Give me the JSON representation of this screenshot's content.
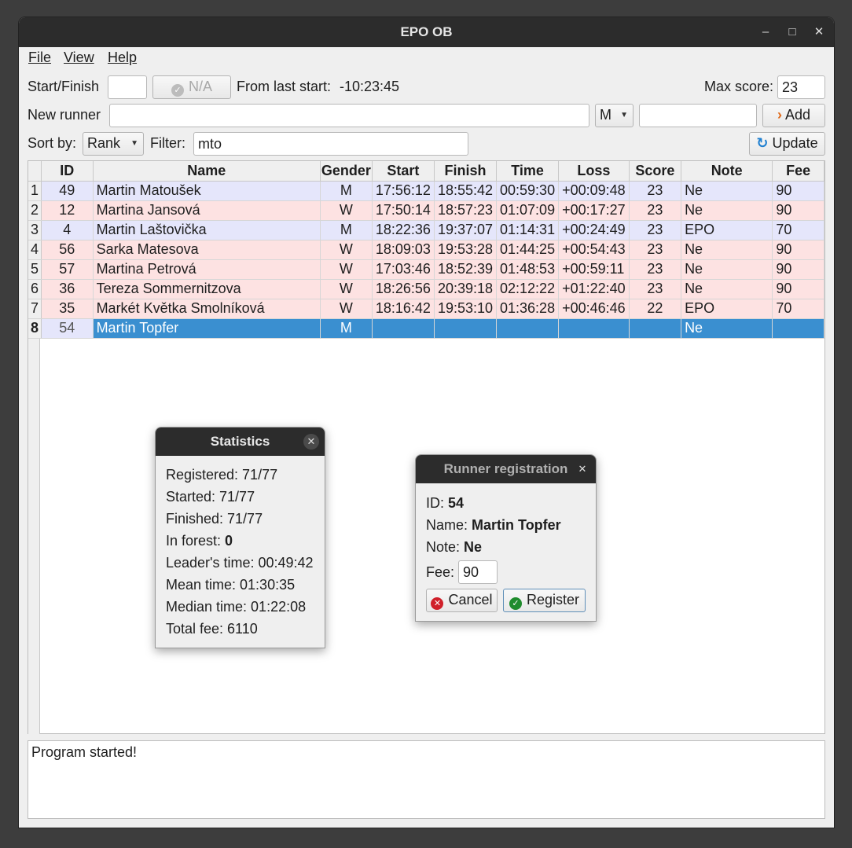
{
  "window": {
    "title": "EPO OB"
  },
  "menu": {
    "file": "File",
    "view": "View",
    "help": "Help"
  },
  "toolbar": {
    "start_finish_label": "Start/Finish",
    "start_finish_value": "",
    "na_button": "N/A",
    "from_last_start_label": "From last start:",
    "from_last_start_value": "-10:23:45",
    "max_score_label": "Max score:",
    "max_score_value": "23",
    "new_runner_label": "New runner",
    "new_runner_value": "",
    "gender_value": "M",
    "runner_extra_value": "",
    "add_button": "Add",
    "sort_by_label": "Sort by:",
    "sort_by_value": "Rank",
    "filter_label": "Filter:",
    "filter_value": "mto",
    "update_button": "Update"
  },
  "table": {
    "headers": [
      "ID",
      "Name",
      "Gender",
      "Start",
      "Finish",
      "Time",
      "Loss",
      "Score",
      "Note",
      "Fee"
    ],
    "rows": [
      {
        "n": "1",
        "id": "49",
        "name": "Martin Matoušek",
        "gender": "M",
        "start": "17:56:12",
        "finish": "18:55:42",
        "time": "00:59:30",
        "loss": "+00:09:48",
        "score": "23",
        "note": "Ne",
        "fee": "90"
      },
      {
        "n": "2",
        "id": "12",
        "name": "Martina Jansová",
        "gender": "W",
        "start": "17:50:14",
        "finish": "18:57:23",
        "time": "01:07:09",
        "loss": "+00:17:27",
        "score": "23",
        "note": "Ne",
        "fee": "90"
      },
      {
        "n": "3",
        "id": "4",
        "name": "Martin Laštovička",
        "gender": "M",
        "start": "18:22:36",
        "finish": "19:37:07",
        "time": "01:14:31",
        "loss": "+00:24:49",
        "score": "23",
        "note": "EPO",
        "fee": "70"
      },
      {
        "n": "4",
        "id": "56",
        "name": "Sarka Matesova",
        "gender": "W",
        "start": "18:09:03",
        "finish": "19:53:28",
        "time": "01:44:25",
        "loss": "+00:54:43",
        "score": "23",
        "note": "Ne",
        "fee": "90"
      },
      {
        "n": "5",
        "id": "57",
        "name": "Martina Petrová",
        "gender": "W",
        "start": "17:03:46",
        "finish": "18:52:39",
        "time": "01:48:53",
        "loss": "+00:59:11",
        "score": "23",
        "note": "Ne",
        "fee": "90"
      },
      {
        "n": "6",
        "id": "36",
        "name": "Tereza Sommernitzova",
        "gender": "W",
        "start": "18:26:56",
        "finish": "20:39:18",
        "time": "02:12:22",
        "loss": "+01:22:40",
        "score": "23",
        "note": "Ne",
        "fee": "90"
      },
      {
        "n": "7",
        "id": "35",
        "name": "Markét Květka Smolníková",
        "gender": "W",
        "start": "18:16:42",
        "finish": "19:53:10",
        "time": "01:36:28",
        "loss": "+00:46:46",
        "score": "22",
        "note": "EPO",
        "fee": "70"
      },
      {
        "n": "8",
        "id": "54",
        "name": "Martin Topfer",
        "gender": "M",
        "start": "",
        "finish": "",
        "time": "",
        "loss": "",
        "score": "",
        "note": "Ne",
        "fee": ""
      }
    ]
  },
  "log": {
    "text": "Program started!"
  },
  "statistics": {
    "title": "Statistics",
    "registered": "Registered: 71/77",
    "started": "Started: 71/77",
    "finished": "Finished: 71/77",
    "in_forest_label": "In forest: ",
    "in_forest_value": "0",
    "leaders_time": "Leader's time: 00:49:42",
    "mean_time": "Mean time: 01:30:35",
    "median_time": "Median time: 01:22:08",
    "total_fee": "Total fee: 6110"
  },
  "registration": {
    "title": "Runner registration",
    "id_label": "ID: ",
    "id_value": "54",
    "name_label": "Name: ",
    "name_value": "Martin Topfer",
    "note_label": "Note: ",
    "note_value": "Ne",
    "fee_label": "Fee:",
    "fee_value": "90",
    "cancel_button": "Cancel",
    "register_button": "Register"
  },
  "colors": {
    "male_row": "#e5e6fb",
    "female_row": "#fde2e2",
    "selected_row": "#3a8fd0",
    "accent": "#1e7fd0"
  }
}
